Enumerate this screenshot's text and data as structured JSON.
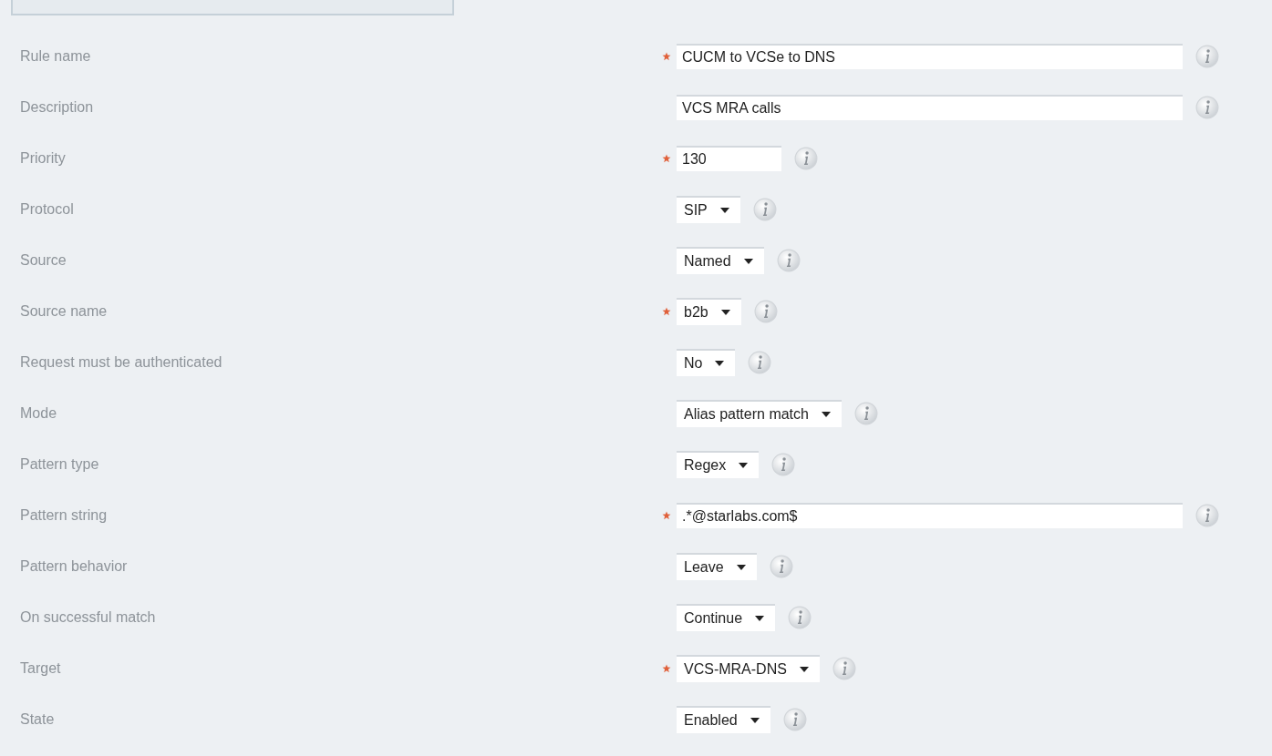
{
  "fields": [
    {
      "label": "Rule name",
      "required": true,
      "kind": "text",
      "value": "CUCM to VCSe to DNS"
    },
    {
      "label": "Description",
      "required": false,
      "kind": "text",
      "value": "VCS MRA calls"
    },
    {
      "label": "Priority",
      "required": true,
      "kind": "number",
      "value": "130"
    },
    {
      "label": "Protocol",
      "required": false,
      "kind": "select",
      "value": "SIP"
    },
    {
      "label": "Source",
      "required": false,
      "kind": "select",
      "value": "Named"
    },
    {
      "label": "Source name",
      "required": true,
      "kind": "select",
      "value": "b2b"
    },
    {
      "label": "Request must be authenticated",
      "required": false,
      "kind": "select",
      "value": "No"
    },
    {
      "label": "Mode",
      "required": false,
      "kind": "select",
      "value": "Alias pattern match"
    },
    {
      "label": "Pattern type",
      "required": false,
      "kind": "select",
      "value": "Regex"
    },
    {
      "label": "Pattern string",
      "required": true,
      "kind": "text",
      "value": ".*@starlabs.com$"
    },
    {
      "label": "Pattern behavior",
      "required": false,
      "kind": "select",
      "value": "Leave"
    },
    {
      "label": "On successful match",
      "required": false,
      "kind": "select",
      "value": "Continue"
    },
    {
      "label": "Target",
      "required": true,
      "kind": "select",
      "value": "VCS-MRA-DNS"
    },
    {
      "label": "State",
      "required": false,
      "kind": "select",
      "value": "Enabled"
    }
  ]
}
